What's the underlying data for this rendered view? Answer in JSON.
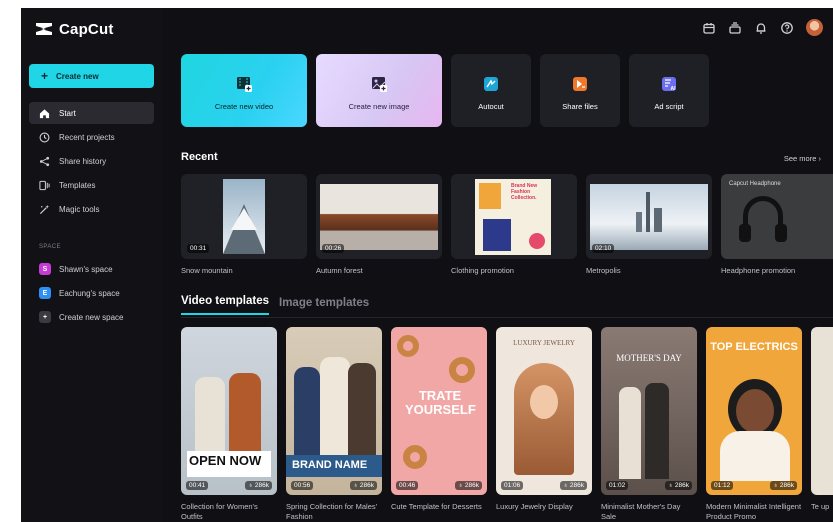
{
  "app": {
    "name": "CapCut"
  },
  "sidebar": {
    "create_new": "Create new",
    "items": [
      {
        "label": "Start",
        "icon": "home-icon",
        "active": true
      },
      {
        "label": "Recent projects",
        "icon": "clock-icon"
      },
      {
        "label": "Share history",
        "icon": "share-icon"
      },
      {
        "label": "Templates",
        "icon": "template-icon"
      },
      {
        "label": "Magic tools",
        "icon": "magic-wand-icon"
      }
    ],
    "space_label": "SPACE",
    "spaces": [
      {
        "badge": "S",
        "label": "Shawn's space",
        "color": "#c43bd6"
      },
      {
        "badge": "E",
        "label": "Eachung's space",
        "color": "#2e8ff5"
      },
      {
        "badge": "+",
        "label": "Create new space",
        "color": "#3a3b42"
      }
    ]
  },
  "actions": [
    {
      "label": "Create new video",
      "icon": "video-plus-icon"
    },
    {
      "label": "Create new image",
      "icon": "image-plus-icon"
    },
    {
      "label": "Autocut",
      "icon": "autocut-icon"
    },
    {
      "label": "Share files",
      "icon": "share-files-icon"
    },
    {
      "label": "Ad script",
      "icon": "ad-script-icon"
    }
  ],
  "recent": {
    "title": "Recent",
    "see_more": "See more",
    "items": [
      {
        "name": "Snow mountain",
        "duration": "00:31"
      },
      {
        "name": "Autumn forest",
        "duration": "00:26"
      },
      {
        "name": "Clothing promotion",
        "duration": "",
        "overlay": "Brand New Fashion Collection."
      },
      {
        "name": "Metropolis",
        "duration": "02:10"
      },
      {
        "name": "Headphone promotion",
        "duration": "",
        "overlay": "Capcut Headphone"
      }
    ]
  },
  "templates": {
    "tabs": [
      "Video templates",
      "Image templates"
    ],
    "items": [
      {
        "name": "Collection for Women's Outfits",
        "duration": "00:41",
        "likes": "286k",
        "overlay": "OPEN NOW"
      },
      {
        "name": "Spring Collection for Males' Fashion",
        "duration": "00:56",
        "likes": "286k",
        "overlay": "BRAND NAME"
      },
      {
        "name": "Cute Template for Desserts",
        "duration": "00:46",
        "likes": "286k",
        "overlay": "TRATE YOURSELF"
      },
      {
        "name": "Luxury Jewelry Display",
        "duration": "01:06",
        "likes": "286k",
        "overlay": "LUXURY JEWELRY"
      },
      {
        "name": "Minimalist Mother's Day Sale",
        "duration": "01:02",
        "likes": "286k",
        "overlay": "MOTHER'S DAY"
      },
      {
        "name": "Modern Minimalist Intelligent Product Promo",
        "duration": "01:12",
        "likes": "286k",
        "overlay": "TOP ELECTRICS"
      },
      {
        "name": "Te up",
        "duration": "",
        "likes": ""
      }
    ]
  }
}
